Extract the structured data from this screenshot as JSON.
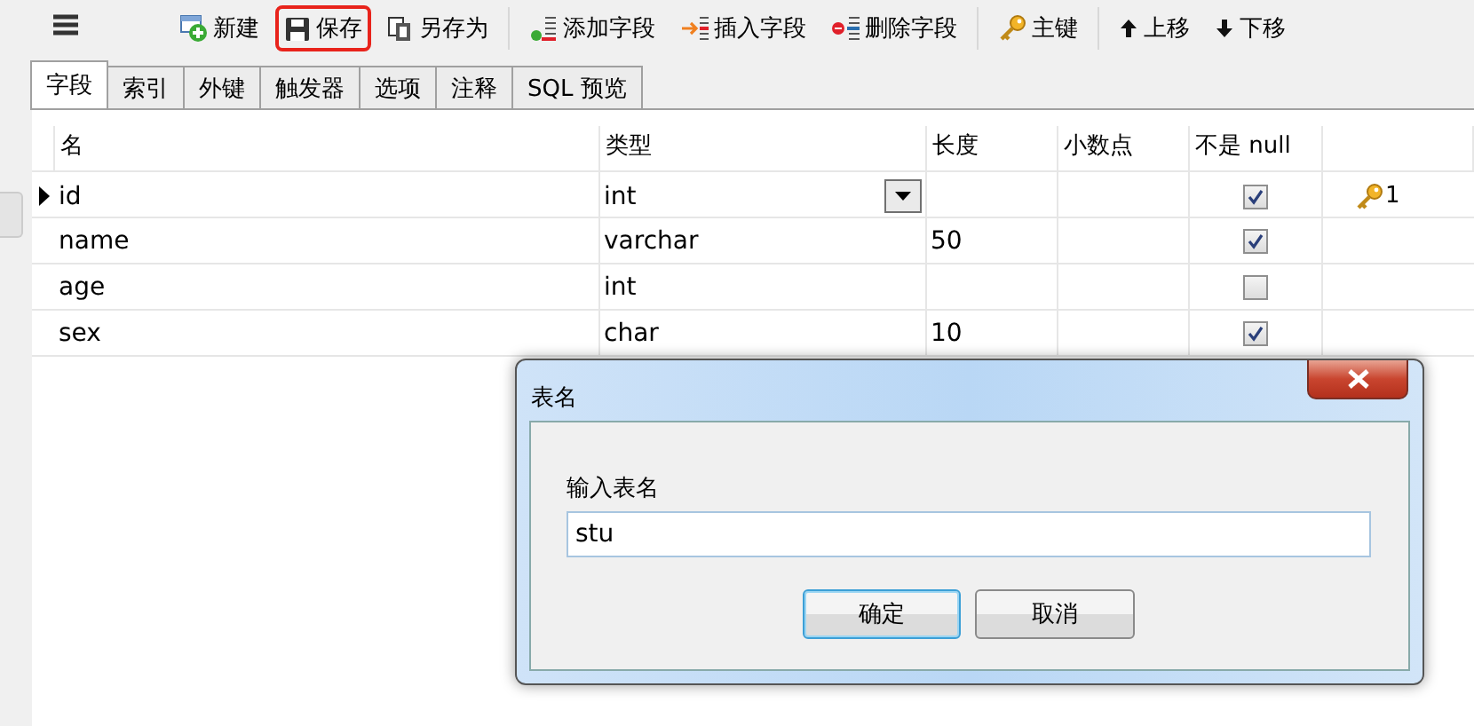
{
  "toolbar": {
    "groups": [
      [
        {
          "label": "新建",
          "kind": "new",
          "highlighted": false
        },
        {
          "label": "保存",
          "kind": "save",
          "highlighted": true
        },
        {
          "label": "另存为",
          "kind": "saveas",
          "highlighted": false
        }
      ],
      [
        {
          "label": "添加字段",
          "kind": "add",
          "highlighted": false
        },
        {
          "label": "插入字段",
          "kind": "insert",
          "highlighted": false
        },
        {
          "label": "删除字段",
          "kind": "delete",
          "highlighted": false
        }
      ],
      [
        {
          "label": "主键",
          "kind": "key",
          "highlighted": false
        }
      ],
      [
        {
          "label": "上移",
          "kind": "up",
          "highlighted": false
        },
        {
          "label": "下移",
          "kind": "down",
          "highlighted": false
        }
      ]
    ]
  },
  "tabs": [
    {
      "label": "字段",
      "selected": true
    },
    {
      "label": "索引",
      "selected": false
    },
    {
      "label": "外键",
      "selected": false
    },
    {
      "label": "触发器",
      "selected": false
    },
    {
      "label": "选项",
      "selected": false
    },
    {
      "label": "注释",
      "selected": false
    },
    {
      "label": "SQL 预览",
      "selected": false
    }
  ],
  "table": {
    "columns": [
      "名",
      "类型",
      "长度",
      "小数点",
      "不是 null"
    ],
    "rows": [
      {
        "name": "id",
        "type": "int",
        "length": "",
        "decimals": "",
        "not_null": true,
        "key": "1",
        "current": true,
        "editing": true
      },
      {
        "name": "name",
        "type": "varchar",
        "length": "50",
        "decimals": "",
        "not_null": true,
        "key": "",
        "current": false,
        "editing": false
      },
      {
        "name": "age",
        "type": "int",
        "length": "",
        "decimals": "",
        "not_null": false,
        "key": "",
        "current": false,
        "editing": false
      },
      {
        "name": "sex",
        "type": "char",
        "length": "10",
        "decimals": "",
        "not_null": true,
        "key": "",
        "current": false,
        "editing": false
      }
    ]
  },
  "dialog": {
    "title": "表名",
    "label": "输入表名",
    "value": "stu",
    "buttons": [
      {
        "label": "确定",
        "default": true
      },
      {
        "label": "取消",
        "default": false
      }
    ]
  }
}
